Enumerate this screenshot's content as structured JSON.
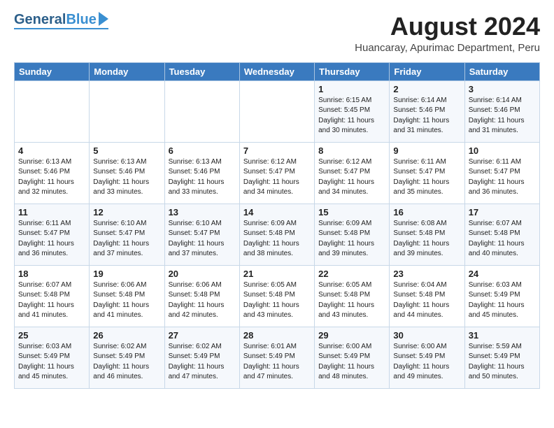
{
  "header": {
    "logo_general": "General",
    "logo_blue": "Blue",
    "main_title": "August 2024",
    "subtitle": "Huancaray, Apurimac Department, Peru"
  },
  "calendar": {
    "days_of_week": [
      "Sunday",
      "Monday",
      "Tuesday",
      "Wednesday",
      "Thursday",
      "Friday",
      "Saturday"
    ],
    "weeks": [
      [
        {
          "day": "",
          "info": ""
        },
        {
          "day": "",
          "info": ""
        },
        {
          "day": "",
          "info": ""
        },
        {
          "day": "",
          "info": ""
        },
        {
          "day": "1",
          "info": "Sunrise: 6:15 AM\nSunset: 5:45 PM\nDaylight: 11 hours\nand 30 minutes."
        },
        {
          "day": "2",
          "info": "Sunrise: 6:14 AM\nSunset: 5:46 PM\nDaylight: 11 hours\nand 31 minutes."
        },
        {
          "day": "3",
          "info": "Sunrise: 6:14 AM\nSunset: 5:46 PM\nDaylight: 11 hours\nand 31 minutes."
        }
      ],
      [
        {
          "day": "4",
          "info": "Sunrise: 6:13 AM\nSunset: 5:46 PM\nDaylight: 11 hours\nand 32 minutes."
        },
        {
          "day": "5",
          "info": "Sunrise: 6:13 AM\nSunset: 5:46 PM\nDaylight: 11 hours\nand 33 minutes."
        },
        {
          "day": "6",
          "info": "Sunrise: 6:13 AM\nSunset: 5:46 PM\nDaylight: 11 hours\nand 33 minutes."
        },
        {
          "day": "7",
          "info": "Sunrise: 6:12 AM\nSunset: 5:47 PM\nDaylight: 11 hours\nand 34 minutes."
        },
        {
          "day": "8",
          "info": "Sunrise: 6:12 AM\nSunset: 5:47 PM\nDaylight: 11 hours\nand 34 minutes."
        },
        {
          "day": "9",
          "info": "Sunrise: 6:11 AM\nSunset: 5:47 PM\nDaylight: 11 hours\nand 35 minutes."
        },
        {
          "day": "10",
          "info": "Sunrise: 6:11 AM\nSunset: 5:47 PM\nDaylight: 11 hours\nand 36 minutes."
        }
      ],
      [
        {
          "day": "11",
          "info": "Sunrise: 6:11 AM\nSunset: 5:47 PM\nDaylight: 11 hours\nand 36 minutes."
        },
        {
          "day": "12",
          "info": "Sunrise: 6:10 AM\nSunset: 5:47 PM\nDaylight: 11 hours\nand 37 minutes."
        },
        {
          "day": "13",
          "info": "Sunrise: 6:10 AM\nSunset: 5:47 PM\nDaylight: 11 hours\nand 37 minutes."
        },
        {
          "day": "14",
          "info": "Sunrise: 6:09 AM\nSunset: 5:48 PM\nDaylight: 11 hours\nand 38 minutes."
        },
        {
          "day": "15",
          "info": "Sunrise: 6:09 AM\nSunset: 5:48 PM\nDaylight: 11 hours\nand 39 minutes."
        },
        {
          "day": "16",
          "info": "Sunrise: 6:08 AM\nSunset: 5:48 PM\nDaylight: 11 hours\nand 39 minutes."
        },
        {
          "day": "17",
          "info": "Sunrise: 6:07 AM\nSunset: 5:48 PM\nDaylight: 11 hours\nand 40 minutes."
        }
      ],
      [
        {
          "day": "18",
          "info": "Sunrise: 6:07 AM\nSunset: 5:48 PM\nDaylight: 11 hours\nand 41 minutes."
        },
        {
          "day": "19",
          "info": "Sunrise: 6:06 AM\nSunset: 5:48 PM\nDaylight: 11 hours\nand 41 minutes."
        },
        {
          "day": "20",
          "info": "Sunrise: 6:06 AM\nSunset: 5:48 PM\nDaylight: 11 hours\nand 42 minutes."
        },
        {
          "day": "21",
          "info": "Sunrise: 6:05 AM\nSunset: 5:48 PM\nDaylight: 11 hours\nand 43 minutes."
        },
        {
          "day": "22",
          "info": "Sunrise: 6:05 AM\nSunset: 5:48 PM\nDaylight: 11 hours\nand 43 minutes."
        },
        {
          "day": "23",
          "info": "Sunrise: 6:04 AM\nSunset: 5:48 PM\nDaylight: 11 hours\nand 44 minutes."
        },
        {
          "day": "24",
          "info": "Sunrise: 6:03 AM\nSunset: 5:49 PM\nDaylight: 11 hours\nand 45 minutes."
        }
      ],
      [
        {
          "day": "25",
          "info": "Sunrise: 6:03 AM\nSunset: 5:49 PM\nDaylight: 11 hours\nand 45 minutes."
        },
        {
          "day": "26",
          "info": "Sunrise: 6:02 AM\nSunset: 5:49 PM\nDaylight: 11 hours\nand 46 minutes."
        },
        {
          "day": "27",
          "info": "Sunrise: 6:02 AM\nSunset: 5:49 PM\nDaylight: 11 hours\nand 47 minutes."
        },
        {
          "day": "28",
          "info": "Sunrise: 6:01 AM\nSunset: 5:49 PM\nDaylight: 11 hours\nand 47 minutes."
        },
        {
          "day": "29",
          "info": "Sunrise: 6:00 AM\nSunset: 5:49 PM\nDaylight: 11 hours\nand 48 minutes."
        },
        {
          "day": "30",
          "info": "Sunrise: 6:00 AM\nSunset: 5:49 PM\nDaylight: 11 hours\nand 49 minutes."
        },
        {
          "day": "31",
          "info": "Sunrise: 5:59 AM\nSunset: 5:49 PM\nDaylight: 11 hours\nand 50 minutes."
        }
      ]
    ]
  }
}
